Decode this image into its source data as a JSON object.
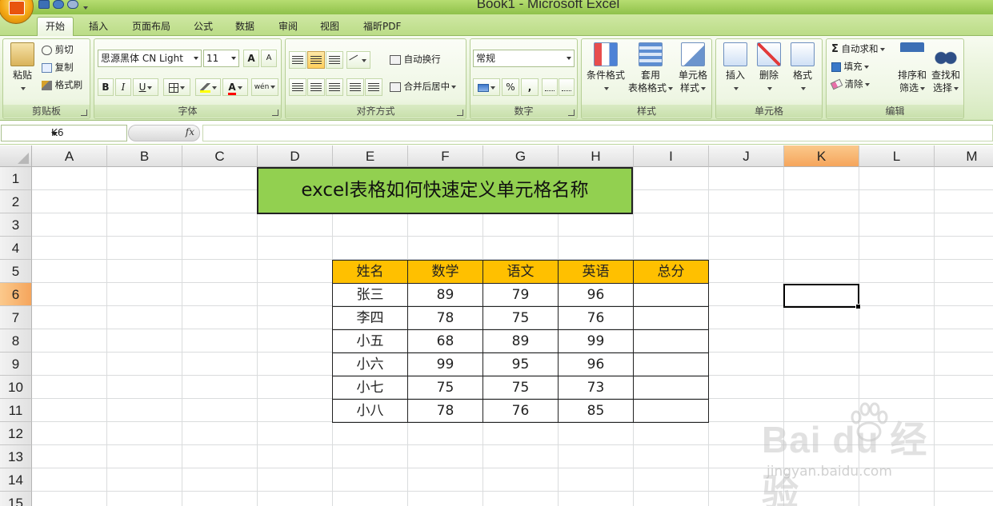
{
  "window": {
    "title": "Book1 - Microsoft Excel"
  },
  "tabs": [
    "开始",
    "插入",
    "页面布局",
    "公式",
    "数据",
    "审阅",
    "视图",
    "福昕PDF"
  ],
  "active_tab": "开始",
  "ribbon": {
    "clipboard": {
      "label": "剪贴板",
      "paste": "粘贴",
      "cut": "剪切",
      "copy": "复制",
      "format_painter": "格式刷"
    },
    "font": {
      "label": "字体",
      "font_name": "思源黑体 CN Light",
      "font_size": "11",
      "bold": "B",
      "italic": "I",
      "underline": "U",
      "grow": "A",
      "shrink": "A",
      "font_color": "A",
      "phonetic": "wén"
    },
    "alignment": {
      "label": "对齐方式",
      "wrap_text": "自动换行",
      "merge_center": "合并后居中"
    },
    "number": {
      "label": "数字",
      "format": "常规",
      "percent": "%",
      "comma": ","
    },
    "styles": {
      "label": "样式",
      "conditional": "条件格式",
      "table_format_1": "套用",
      "table_format_2": "表格格式",
      "cell_style_1": "单元格",
      "cell_style_2": "样式"
    },
    "cells": {
      "label": "单元格",
      "insert": "插入",
      "delete": "删除",
      "format": "格式"
    },
    "editing": {
      "label": "编辑",
      "autosum": "自动求和",
      "fill": "填充",
      "clear": "清除",
      "sort_1": "排序和",
      "sort_2": "筛选",
      "find_1": "查找和",
      "find_2": "选择"
    }
  },
  "formula_bar": {
    "name_box": "K6",
    "fx": "fx",
    "formula": ""
  },
  "sheet": {
    "columns": [
      "A",
      "B",
      "C",
      "D",
      "E",
      "F",
      "G",
      "H",
      "I",
      "J",
      "K",
      "L",
      "M"
    ],
    "rows": [
      "1",
      "2",
      "3",
      "4",
      "5",
      "6",
      "7",
      "8",
      "9",
      "10",
      "11",
      "12",
      "13",
      "14",
      "15"
    ],
    "selected_column": "K",
    "selected_row": "6",
    "title_cell": "excel表格如何快速定义单元格名称",
    "table": {
      "headers": [
        "姓名",
        "数学",
        "语文",
        "英语",
        "总分"
      ],
      "rows": [
        [
          "张三",
          "89",
          "79",
          "96",
          ""
        ],
        [
          "李四",
          "78",
          "75",
          "76",
          ""
        ],
        [
          "小五",
          "68",
          "89",
          "99",
          ""
        ],
        [
          "小六",
          "99",
          "95",
          "96",
          ""
        ],
        [
          "小七",
          "75",
          "75",
          "73",
          ""
        ],
        [
          "小八",
          "78",
          "76",
          "85",
          ""
        ]
      ]
    }
  },
  "watermark": {
    "brand": "Bai du 经验",
    "url": "jingyan.baidu.com"
  }
}
